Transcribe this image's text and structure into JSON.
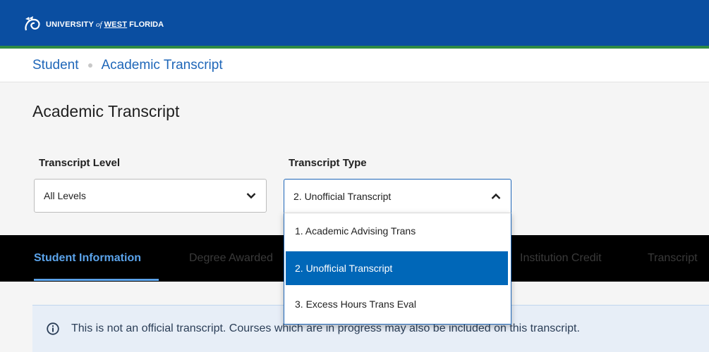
{
  "header": {
    "logo_text_1": "UNIVERSITY",
    "logo_text_2": "of",
    "logo_text_3": "WEST",
    "logo_text_4": "FLORIDA"
  },
  "breadcrumb": [
    "Student",
    "Academic Transcript"
  ],
  "page_title": "Academic Transcript",
  "filters": {
    "level_label": "Transcript Level",
    "level_value": "All Levels",
    "type_label": "Transcript Type",
    "type_value": "2. Unofficial Transcript",
    "type_options": [
      "1. Academic Advising Trans",
      "2. Unofficial Transcript",
      "3. Excess Hours Trans Eval"
    ],
    "type_selected_index": 1
  },
  "tabs": [
    {
      "label": "Student Information",
      "active": true
    },
    {
      "label": "Degree Awarded",
      "active": false
    },
    {
      "label": "Institution Credit",
      "active": false
    },
    {
      "label": "Transcript",
      "active": false
    }
  ],
  "notice": "This is not an official transcript. Courses which are in progress may also be included on this transcript.",
  "colors": {
    "brand_blue": "#0a4ea1",
    "brand_green": "#2e8b45",
    "link_blue": "#1e66b8",
    "selected_option": "#0067b8",
    "active_tab": "#5ba3ea"
  }
}
